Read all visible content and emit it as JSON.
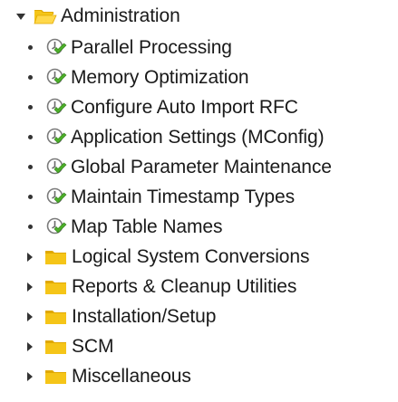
{
  "tree": {
    "root": {
      "label": "Administration",
      "expanded": true,
      "icon": "folder-open-icon"
    },
    "children": [
      {
        "type": "transaction",
        "label": "Parallel Processing",
        "icon": "execute-clock-icon"
      },
      {
        "type": "transaction",
        "label": "Memory Optimization",
        "icon": "execute-clock-icon"
      },
      {
        "type": "transaction",
        "label": "Configure Auto Import RFC",
        "icon": "execute-clock-icon"
      },
      {
        "type": "transaction",
        "label": "Application Settings (MConfig)",
        "icon": "execute-clock-icon"
      },
      {
        "type": "transaction",
        "label": "Global Parameter Maintenance",
        "icon": "execute-clock-icon"
      },
      {
        "type": "transaction",
        "label": "Maintain Timestamp Types",
        "icon": "execute-clock-icon"
      },
      {
        "type": "transaction",
        "label": "Map Table Names",
        "icon": "execute-clock-icon"
      },
      {
        "type": "folder",
        "label": "Logical System Conversions",
        "expanded": false,
        "icon": "folder-icon"
      },
      {
        "type": "folder",
        "label": "Reports & Cleanup Utilities",
        "expanded": false,
        "icon": "folder-icon"
      },
      {
        "type": "folder",
        "label": "Installation/Setup",
        "expanded": false,
        "icon": "folder-icon"
      },
      {
        "type": "folder",
        "label": "SCM",
        "expanded": false,
        "icon": "folder-icon"
      },
      {
        "type": "folder",
        "label": "Miscellaneous",
        "expanded": false,
        "icon": "folder-icon"
      }
    ]
  },
  "colors": {
    "folder": "#f5c518",
    "folder_dark": "#e0a800",
    "check_green": "#4caf2a",
    "clock_gray": "#8a8a8a",
    "text": "#1a1a1a"
  }
}
